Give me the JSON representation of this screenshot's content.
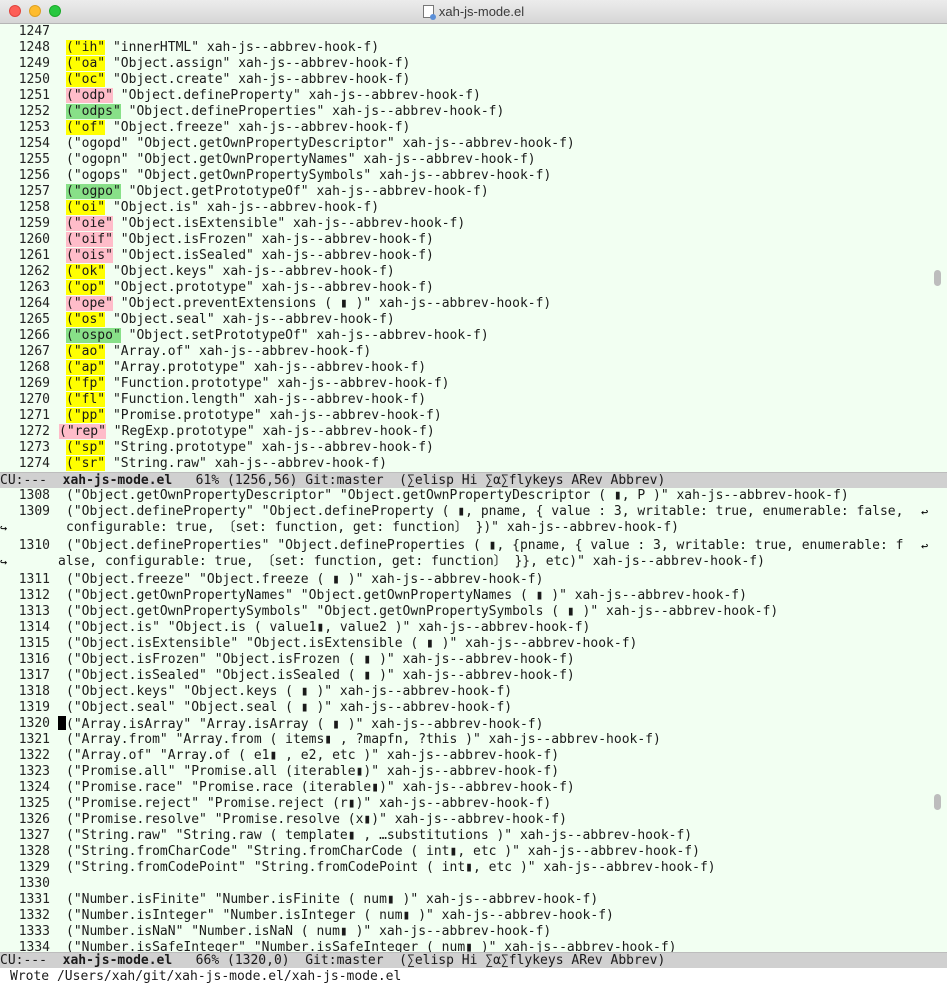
{
  "window": {
    "title": "xah-js-mode.el"
  },
  "pane1": {
    "lines": [
      {
        "n": "1247",
        "pre": "",
        "key": "",
        "hl": "",
        "post": ""
      },
      {
        "n": "1248",
        "pre": "",
        "key": "(\"ih\"",
        "hl": "y",
        "post": " \"innerHTML\" xah-js--abbrev-hook-f)"
      },
      {
        "n": "1249",
        "pre": "",
        "key": "(\"oa\"",
        "hl": "y",
        "post": " \"Object.assign\" xah-js--abbrev-hook-f)"
      },
      {
        "n": "1250",
        "pre": "",
        "key": "(\"oc\"",
        "hl": "y",
        "post": " \"Object.create\" xah-js--abbrev-hook-f)"
      },
      {
        "n": "1251",
        "pre": "",
        "key": "(\"odp\"",
        "hl": "p",
        "post": " \"Object.defineProperty\" xah-js--abbrev-hook-f)"
      },
      {
        "n": "1252",
        "pre": "",
        "key": "(\"odps\"",
        "hl": "g",
        "post": " \"Object.defineProperties\" xah-js--abbrev-hook-f)"
      },
      {
        "n": "1253",
        "pre": "",
        "key": "(\"of\"",
        "hl": "y",
        "post": " \"Object.freeze\" xah-js--abbrev-hook-f)"
      },
      {
        "n": "1254",
        "pre": "",
        "key": "(\"ogopd\"",
        "hl": "",
        "post": " \"Object.getOwnPropertyDescriptor\" xah-js--abbrev-hook-f)"
      },
      {
        "n": "1255",
        "pre": "",
        "key": "(\"ogopn\"",
        "hl": "",
        "post": " \"Object.getOwnPropertyNames\" xah-js--abbrev-hook-f)"
      },
      {
        "n": "1256",
        "pre": "",
        "key": "(\"ogops\"",
        "hl": "",
        "post": " \"Object.getOwnPropertySymbols\" xah-js--abbrev-hook-f)"
      },
      {
        "n": "1257",
        "pre": "",
        "key": "(\"ogpo\"",
        "hl": "g",
        "post": " \"Object.getPrototypeOf\" xah-js--abbrev-hook-f)"
      },
      {
        "n": "1258",
        "pre": "",
        "key": "(\"oi\"",
        "hl": "y",
        "post": " \"Object.is\" xah-js--abbrev-hook-f)"
      },
      {
        "n": "1259",
        "pre": "",
        "key": "(\"oie\"",
        "hl": "p",
        "post": " \"Object.isExtensible\" xah-js--abbrev-hook-f)"
      },
      {
        "n": "1260",
        "pre": "",
        "key": "(\"oif\"",
        "hl": "p",
        "post": " \"Object.isFrozen\" xah-js--abbrev-hook-f)"
      },
      {
        "n": "1261",
        "pre": "",
        "key": "(\"ois\"",
        "hl": "p",
        "post": " \"Object.isSealed\" xah-js--abbrev-hook-f)"
      },
      {
        "n": "1262",
        "pre": "",
        "key": "(\"ok\"",
        "hl": "y",
        "post": " \"Object.keys\" xah-js--abbrev-hook-f)"
      },
      {
        "n": "1263",
        "pre": "",
        "key": "(\"op\"",
        "hl": "y",
        "post": " \"Object.prototype\" xah-js--abbrev-hook-f)"
      },
      {
        "n": "1264",
        "pre": "",
        "key": "(\"ope\"",
        "hl": "p",
        "post": " \"Object.preventExtensions ( ▮ )\" xah-js--abbrev-hook-f)"
      },
      {
        "n": "1265",
        "pre": "",
        "key": "(\"os\"",
        "hl": "y",
        "post": " \"Object.seal\" xah-js--abbrev-hook-f)"
      },
      {
        "n": "1266",
        "pre": "",
        "key": "(\"ospo\"",
        "hl": "g",
        "post": " \"Object.setPrototypeOf\" xah-js--abbrev-hook-f)"
      },
      {
        "n": "1267",
        "pre": "",
        "key": "(\"ao\"",
        "hl": "y",
        "post": " \"Array.of\" xah-js--abbrev-hook-f)"
      },
      {
        "n": "1268",
        "pre": "",
        "key": "(\"ap\"",
        "hl": "y",
        "post": " \"Array.prototype\" xah-js--abbrev-hook-f)"
      },
      {
        "n": "1269",
        "pre": "",
        "key": "(\"fp\"",
        "hl": "y",
        "post": " \"Function.prototype\" xah-js--abbrev-hook-f)"
      },
      {
        "n": "1270",
        "pre": "",
        "key": "(\"fl\"",
        "hl": "y",
        "post": " \"Function.length\" xah-js--abbrev-hook-f)"
      },
      {
        "n": "1271",
        "pre": "",
        "key": "(\"pp\"",
        "hl": "y",
        "post": " \"Promise.prototype\" xah-js--abbrev-hook-f)"
      },
      {
        "n": "1272",
        "pre": "",
        "key": "(\"rep\"",
        "hl": "p",
        "post": " \"RegExp.prototype\" xah-js--abbrev-hook-f)"
      },
      {
        "n": "1273",
        "pre": "",
        "key": "(\"sp\"",
        "hl": "y",
        "post": " \"String.prototype\" xah-js--abbrev-hook-f)"
      },
      {
        "n": "1274",
        "pre": "",
        "key": "(\"sr\"",
        "hl": "y",
        "post": " \"String.raw\" xah-js--abbrev-hook-f)"
      }
    ],
    "modeline": {
      "status": "CU:---  ",
      "buffer": "xah-js-mode.el",
      "rest": "   61% (1256,56) Git:master  (∑elisp Hi ∑α∑flykeys ARev Abbrev)"
    },
    "scroll_position": 0.55
  },
  "pane2": {
    "lines": [
      {
        "n": "1308",
        "text": "(\"Object.getOwnPropertyDescriptor\" \"Object.getOwnPropertyDescriptor ( ▮, P )\" xah-js--abbrev-hook-f)"
      },
      {
        "n": "1309",
        "text": "(\"Object.defineProperty\" \"Object.defineProperty ( ▮, pname, { value : 3, writable: true, enumerable: false,",
        "wrap": true
      },
      {
        "n": "",
        "text": "configurable: true, 〔set: function, get: function〕 })\" xah-js--abbrev-hook-f)",
        "cont": true
      },
      {
        "n": "1310",
        "text": "(\"Object.defineProperties\" \"Object.defineProperties ( ▮, {pname, { value : 3, writable: true, enumerable: f",
        "wrap": true
      },
      {
        "n": "",
        "text": "alse, configurable: true, 〔set: function, get: function〕 }}, etc)\" xah-js--abbrev-hook-f)",
        "cont": true,
        "contleft": true
      },
      {
        "n": "1311",
        "text": "(\"Object.freeze\" \"Object.freeze ( ▮ )\" xah-js--abbrev-hook-f)"
      },
      {
        "n": "1312",
        "text": "(\"Object.getOwnPropertyNames\" \"Object.getOwnPropertyNames ( ▮ )\" xah-js--abbrev-hook-f)"
      },
      {
        "n": "1313",
        "text": "(\"Object.getOwnPropertySymbols\" \"Object.getOwnPropertySymbols ( ▮ )\" xah-js--abbrev-hook-f)"
      },
      {
        "n": "1314",
        "text": "(\"Object.is\" \"Object.is ( value1▮, value2 )\" xah-js--abbrev-hook-f)"
      },
      {
        "n": "1315",
        "text": "(\"Object.isExtensible\" \"Object.isExtensible ( ▮ )\" xah-js--abbrev-hook-f)"
      },
      {
        "n": "1316",
        "text": "(\"Object.isFrozen\" \"Object.isFrozen ( ▮ )\" xah-js--abbrev-hook-f)"
      },
      {
        "n": "1317",
        "text": "(\"Object.isSealed\" \"Object.isSealed ( ▮ )\" xah-js--abbrev-hook-f)"
      },
      {
        "n": "1318",
        "text": "(\"Object.keys\" \"Object.keys ( ▮ )\" xah-js--abbrev-hook-f)"
      },
      {
        "n": "1319",
        "text": "(\"Object.seal\" \"Object.seal ( ▮ )\" xah-js--abbrev-hook-f)"
      },
      {
        "n": "1320",
        "text": "(\"Array.isArray\" \"Array.isArray ( ▮ )\" xah-js--abbrev-hook-f)",
        "cursor": true
      },
      {
        "n": "1321",
        "text": "(\"Array.from\" \"Array.from ( items▮ , ?mapfn, ?this )\" xah-js--abbrev-hook-f)"
      },
      {
        "n": "1322",
        "text": "(\"Array.of\" \"Array.of ( e1▮ , e2, etc )\" xah-js--abbrev-hook-f)"
      },
      {
        "n": "1323",
        "text": "(\"Promise.all\" \"Promise.all (iterable▮)\" xah-js--abbrev-hook-f)"
      },
      {
        "n": "1324",
        "text": "(\"Promise.race\" \"Promise.race (iterable▮)\" xah-js--abbrev-hook-f)"
      },
      {
        "n": "1325",
        "text": "(\"Promise.reject\" \"Promise.reject (r▮)\" xah-js--abbrev-hook-f)"
      },
      {
        "n": "1326",
        "text": "(\"Promise.resolve\" \"Promise.resolve (x▮)\" xah-js--abbrev-hook-f)"
      },
      {
        "n": "1327",
        "text": "(\"String.raw\" \"String.raw ( template▮ , …substitutions )\" xah-js--abbrev-hook-f)"
      },
      {
        "n": "1328",
        "text": "(\"String.fromCharCode\" \"String.fromCharCode ( int▮, etc )\" xah-js--abbrev-hook-f)"
      },
      {
        "n": "1329",
        "text": "(\"String.fromCodePoint\" \"String.fromCodePoint ( int▮, etc )\" xah-js--abbrev-hook-f)"
      },
      {
        "n": "1330",
        "text": ""
      },
      {
        "n": "1331",
        "text": "(\"Number.isFinite\" \"Number.isFinite ( num▮ )\" xah-js--abbrev-hook-f)"
      },
      {
        "n": "1332",
        "text": "(\"Number.isInteger\" \"Number.isInteger ( num▮ )\" xah-js--abbrev-hook-f)"
      },
      {
        "n": "1333",
        "text": "(\"Number.isNaN\" \"Number.isNaN ( num▮ )\" xah-js--abbrev-hook-f)"
      },
      {
        "n": "1334",
        "text": "(\"Number.isSafeInteger\" \"Number.isSafeInteger ( num▮ )\" xah-js--abbrev-hook-f)"
      }
    ],
    "modeline": {
      "status": "CU:---  ",
      "buffer": "xah-js-mode.el",
      "rest": "   66% (1320,0)  Git:master  (∑elisp Hi ∑α∑flykeys ARev Abbrev)"
    },
    "scroll_position": 0.66
  },
  "minibuffer": {
    "message": "Wrote /Users/xah/git/xah-js-mode.el/xah-js-mode.el"
  },
  "colors": {
    "background": "#f2fff2",
    "hl_yellow": "#ffff00",
    "hl_pink": "#ffbcc9",
    "hl_green": "#88e088",
    "modeline": "#d0d0d0"
  }
}
